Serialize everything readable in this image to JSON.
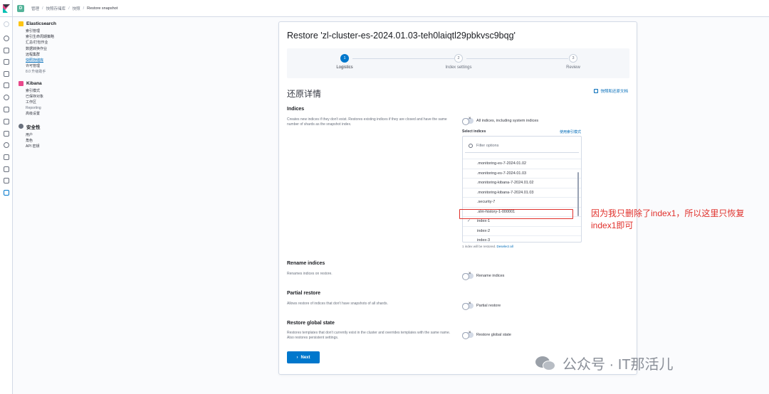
{
  "header": {
    "space_initial": "D",
    "breadcrumbs": [
      "管理",
      "快照存储库",
      "快照",
      "Restore snapshot"
    ]
  },
  "sidenav": {
    "sections": [
      {
        "title": "Elasticsearch",
        "icon_color": "#343741",
        "items": [
          "索引管理",
          "索引生命周期策略",
          "汇总/打包作业",
          "数据转换作业",
          "远程集群",
          "快照存储库",
          "许可管理",
          "8.0 升级助手"
        ],
        "active_index": 5
      },
      {
        "title": "Kibana",
        "icon_color": "#e8488b",
        "items": [
          "索引模式",
          "已保存对象",
          "工作区",
          "Reporting",
          "高级设置"
        ]
      },
      {
        "title": "安全性",
        "icon_color": "#69707d",
        "items": [
          "用户",
          "角色",
          "API 密钥"
        ]
      }
    ]
  },
  "panel": {
    "title": "Restore 'zl-cluster-es-2024.01.03-teh0laiqtl29pbkvsc9bqg'",
    "steps": [
      {
        "num": "1",
        "label": "Logistics",
        "active": true
      },
      {
        "num": "2",
        "label": "Index settings",
        "active": false
      },
      {
        "num": "3",
        "label": "Review",
        "active": false
      }
    ],
    "heading": "还原详情",
    "doc_link": "快照和还原文档",
    "indices": {
      "title": "Indices",
      "desc": "Creates new indices if they don't exist. Restores existing indices if they are closed and have the same number of shards as the snapshot index.",
      "switch_label": "All indices, including system indices",
      "select_label": "Select indices",
      "select_link": "使用索引模式",
      "filter_placeholder": "Filter options",
      "options": [
        ".monitoring-es-7-2024.01.02",
        ".monitoring-es-7-2024.01.03",
        ".monitoring-kibana-7-2024.01.02",
        ".monitoring-kibana-7-2024.01.03",
        ".security-7",
        ".slm-history-1-000001",
        "index-1",
        "index-2",
        "index-3"
      ],
      "checked_option": "index-1",
      "help_text": "1 index will be restored.",
      "help_link": "Deselect all"
    },
    "rename": {
      "title": "Rename indices",
      "desc": "Renames indices on restore.",
      "switch_label": "Rename indices"
    },
    "partial": {
      "title": "Partial restore",
      "desc": "Allows restore of indices that don't have snapshots of all shards.",
      "switch_label": "Partial restore"
    },
    "global": {
      "title": "Restore global state",
      "desc": "Restores templates that don't currently exist in the cluster and overrides templates with the same name. Also restores persistent settings.",
      "switch_label": "Restore global state"
    },
    "next_label": "Next"
  },
  "annotation": "因为我只删除了index1，所以这里只恢复index1即可",
  "watermark": "公众号 · IT那活儿"
}
